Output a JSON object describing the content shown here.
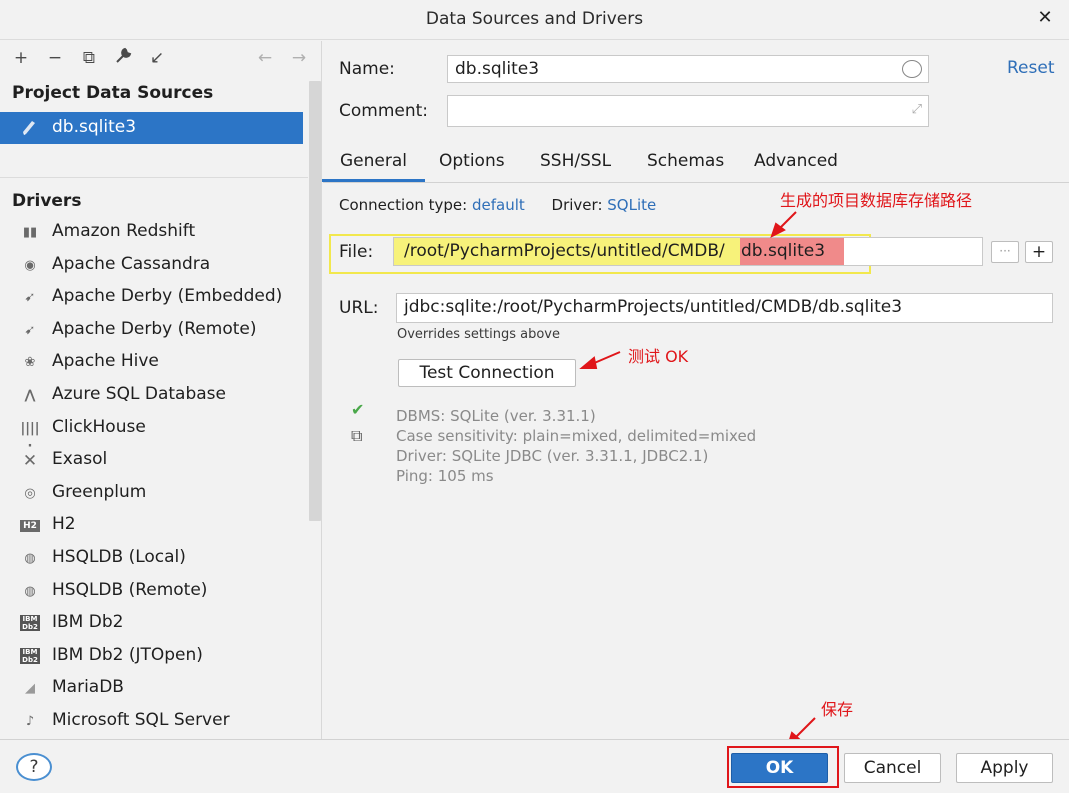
{
  "window": {
    "title": "Data Sources and Drivers"
  },
  "left": {
    "project_header": "Project Data Sources",
    "selected_source": "db.sqlite3",
    "drivers_header": "Drivers",
    "drivers": [
      {
        "label": "Amazon Redshift",
        "icon": "redshift-icon"
      },
      {
        "label": "Apache Cassandra",
        "icon": "cassandra-icon"
      },
      {
        "label": "Apache Derby (Embedded)",
        "icon": "derby-icon"
      },
      {
        "label": "Apache Derby (Remote)",
        "icon": "derby-icon"
      },
      {
        "label": "Apache Hive",
        "icon": "hive-icon"
      },
      {
        "label": "Azure SQL Database",
        "icon": "azure-icon"
      },
      {
        "label": "ClickHouse",
        "icon": "clickhouse-icon"
      },
      {
        "label": "Exasol",
        "icon": "exasol-icon"
      },
      {
        "label": "Greenplum",
        "icon": "greenplum-icon"
      },
      {
        "label": "H2",
        "icon": "h2-icon"
      },
      {
        "label": "HSQLDB (Local)",
        "icon": "hsqldb-icon"
      },
      {
        "label": "HSQLDB (Remote)",
        "icon": "hsqldb-icon"
      },
      {
        "label": "IBM Db2",
        "icon": "db2-icon"
      },
      {
        "label": "IBM Db2 (JTOpen)",
        "icon": "db2-icon"
      },
      {
        "label": "MariaDB",
        "icon": "mariadb-icon"
      },
      {
        "label": "Microsoft SQL Server",
        "icon": "mssql-icon"
      }
    ]
  },
  "form": {
    "name_label": "Name:",
    "name_value": "db.sqlite3",
    "comment_label": "Comment:",
    "comment_value": "",
    "reset": "Reset",
    "tabs": [
      "General",
      "Options",
      "SSH/SSL",
      "Schemas",
      "Advanced"
    ],
    "connection_type_label": "Connection type:",
    "connection_type_value": "default",
    "driver_label": "Driver:",
    "driver_value": "SQLite",
    "file_label": "File:",
    "file_path_prefix": "/root/PycharmProjects/untitled/CMDB/",
    "file_name": "db.sqlite3",
    "url_label": "URL:",
    "url_value": "jdbc:sqlite:/root/PycharmProjects/untitled/CMDB/db.sqlite3",
    "overrides_note": "Overrides settings above",
    "test_connection": "Test Connection",
    "status": [
      "DBMS: SQLite (ver. 3.31.1)",
      "Case sensitivity: plain=mixed, delimited=mixed",
      "Driver: SQLite JDBC (ver. 3.31.1, JDBC2.1)",
      "Ping: 105 ms"
    ]
  },
  "annotations": {
    "path_note": "生成的项目数据库存储路径",
    "test_note": "测试 OK",
    "save_note": "保存"
  },
  "footer": {
    "ok": "OK",
    "cancel": "Cancel",
    "apply": "Apply",
    "help": "?"
  },
  "colors": {
    "selection": "#2c75c6",
    "link": "#2f6fb8",
    "annotation": "#e0161a",
    "file_highlight": "#f7f27a",
    "filename_highlight": "#f08a8a"
  }
}
